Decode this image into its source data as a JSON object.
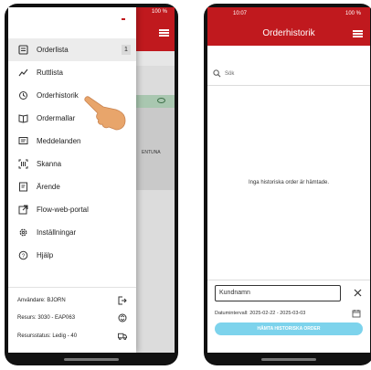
{
  "left_phone": {
    "status_battery": "100 %",
    "background_text": "ENTUNA",
    "menu_items": [
      {
        "label": "Orderlista",
        "icon": "clipboard-list-icon",
        "badge": "1"
      },
      {
        "label": "Ruttlista",
        "icon": "route-line-icon"
      },
      {
        "label": "Orderhistorik",
        "icon": "history-icon"
      },
      {
        "label": "Ordermallar",
        "icon": "book-icon"
      },
      {
        "label": "Meddelanden",
        "icon": "message-icon"
      },
      {
        "label": "Skanna",
        "icon": "barcode-scan-icon"
      },
      {
        "label": "Ärende",
        "icon": "case-icon"
      },
      {
        "label": "Flow-web-portal",
        "icon": "external-link-icon"
      },
      {
        "label": "Inställningar",
        "icon": "gear-icon"
      },
      {
        "label": "Hjälp",
        "icon": "help-icon"
      }
    ],
    "footer": {
      "user": "Användare: BJORN",
      "resource": "Resurs: 3030 - EAP063",
      "resource_status": "Resursstatus: Ledig - 40"
    }
  },
  "right_phone": {
    "status_time": "10:07",
    "status_battery": "100 %",
    "title": "Orderhistorik",
    "search_placeholder": "Sök",
    "empty_message": "Inga historiska order är hämtade.",
    "customer_field": "Kundnamn",
    "date_interval": "Datumintervall: 2025-02-22 - 2025-03-03",
    "fetch_button": "HÄMTA HISTORISKA ORDER"
  },
  "colors": {
    "brand_red": "#c0191e",
    "fetch_button": "#7dd3ec"
  }
}
